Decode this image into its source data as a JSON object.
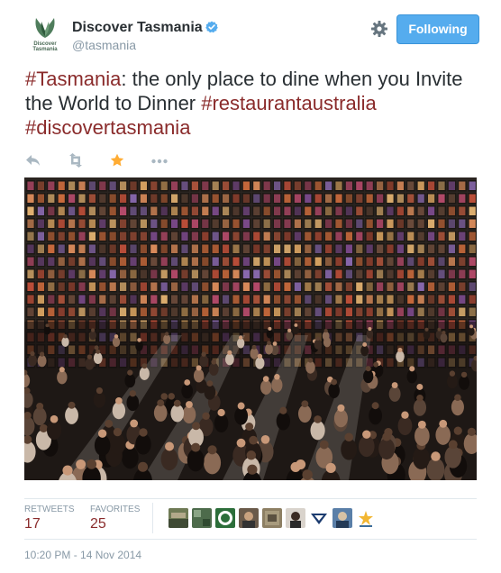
{
  "account": {
    "name": "Discover Tasmania",
    "handle": "@tasmania",
    "avatar_text": "Discover Tasmania",
    "verified": true
  },
  "header": {
    "follow_label": "Following"
  },
  "tweet": {
    "segments": [
      {
        "text": "#Tasmania",
        "hashtag": true
      },
      {
        "text": ": the only place to dine when you Invite the World to Dinner ",
        "hashtag": false
      },
      {
        "text": "#restaurantaustralia",
        "hashtag": true
      },
      {
        "text": " ",
        "hashtag": false
      },
      {
        "text": "#discovertasmania",
        "hashtag": true
      }
    ]
  },
  "actions": [
    {
      "name": "reply-icon"
    },
    {
      "name": "retweet-icon"
    },
    {
      "name": "favorite-icon",
      "active": true
    },
    {
      "name": "more-icon"
    }
  ],
  "stats": {
    "retweets_label": "RETWEETS",
    "retweets_value": "17",
    "favorites_label": "FAVORITES",
    "favorites_value": "25"
  },
  "favorited_by_count_shown": 9,
  "timestamp": "10:20 PM - 14 Nov 2014",
  "colors": {
    "accent": "#55acee",
    "hashtag": "#8a2b2b",
    "muted": "#8899a6",
    "favorite_active": "#ffac33"
  }
}
